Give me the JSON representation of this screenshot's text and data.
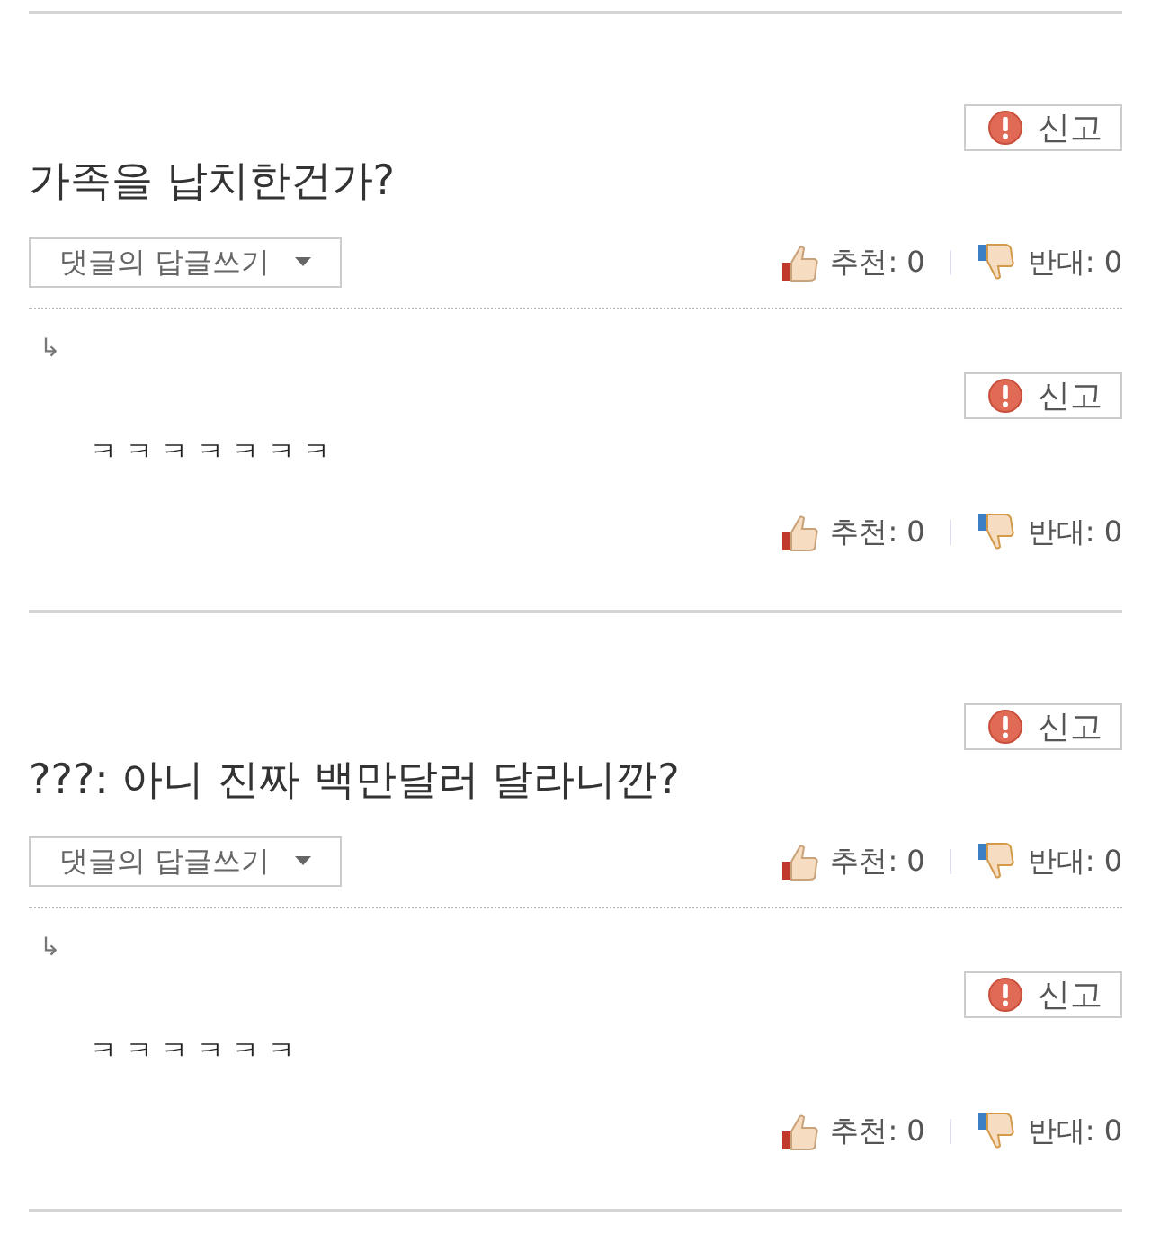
{
  "comments": [
    {
      "report_label": "신고",
      "text": "가족을 납치한건가?",
      "reply_button_label": "댓글의 답글쓰기",
      "likes": "추천: 0",
      "dislikes": "반대: 0",
      "replies": [
        {
          "arrow": "↳",
          "report_label": "신고",
          "text": "ㅋ ㅋ ㅋ ㅋ ㅋ ㅋ ㅋ",
          "likes": "추천: 0",
          "dislikes": "반대: 0"
        }
      ]
    },
    {
      "report_label": "신고",
      "text": "???: 아니 진짜 백만달러 달라니깐?",
      "reply_button_label": "댓글의 답글쓰기",
      "likes": "추천: 0",
      "dislikes": "반대: 0",
      "replies": [
        {
          "arrow": "↳",
          "report_label": "신고",
          "text": "ㅋ ㅋ ㅋ ㅋ ㅋ ㅋ",
          "likes": "추천: 0",
          "dislikes": "반대: 0"
        }
      ]
    }
  ]
}
